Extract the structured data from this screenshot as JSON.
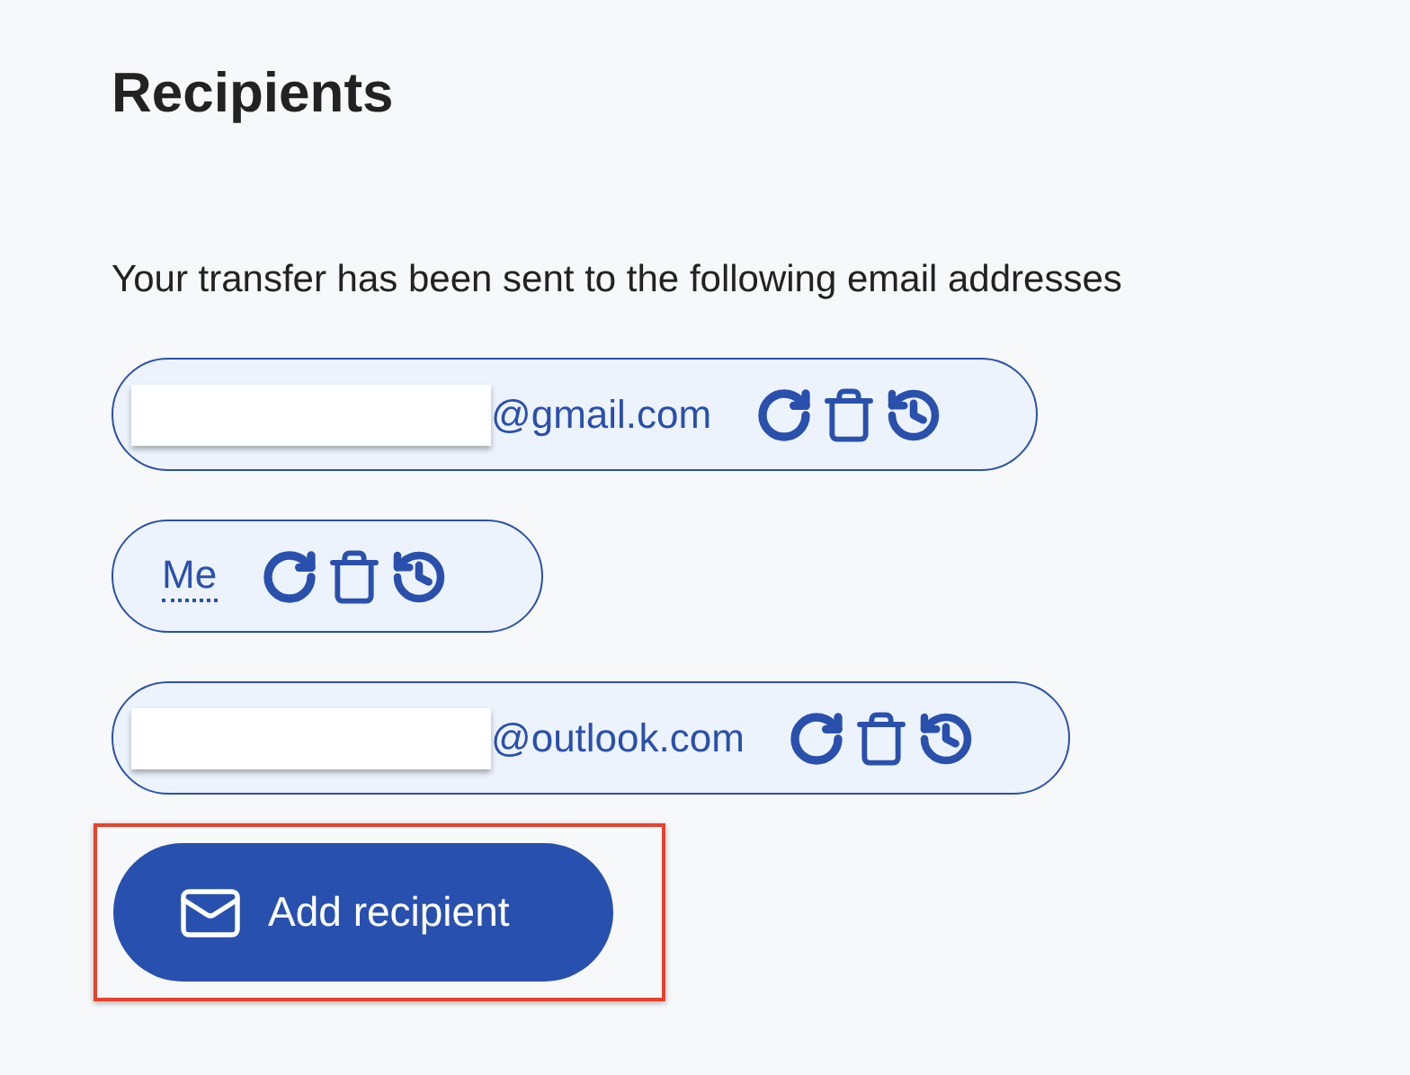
{
  "heading": "Recipients",
  "intro": "Your transfer has been sent to the following email addresses",
  "recipients": [
    {
      "kind": "email",
      "text": "@gmail.com",
      "redacted": true
    },
    {
      "kind": "self",
      "text": "Me",
      "redacted": false
    },
    {
      "kind": "email",
      "text": "@outlook.com",
      "redacted": true
    }
  ],
  "add_button": {
    "label": "Add recipient",
    "highlighted": true
  }
}
